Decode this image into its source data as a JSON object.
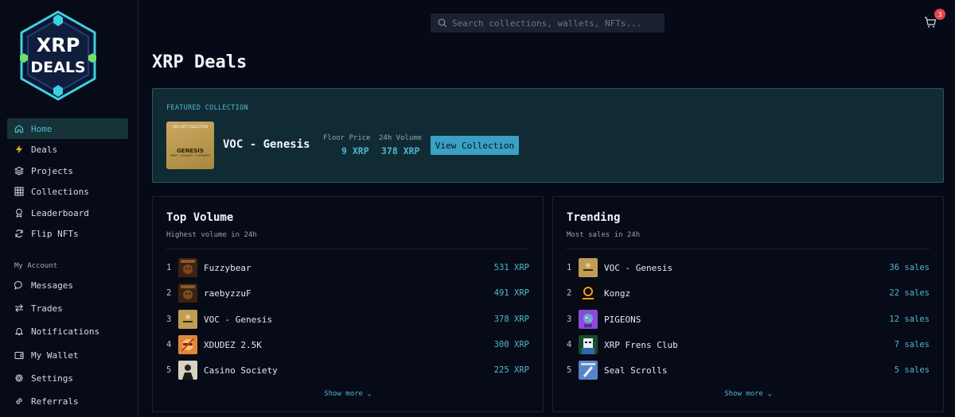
{
  "app": {
    "logo_text_top": "XRP",
    "logo_text_bottom": "DEALS",
    "title": "XRP Deals",
    "accent": "#4fb8cf"
  },
  "sidebar": {
    "items": [
      {
        "label": "Home",
        "icon": "home-icon"
      },
      {
        "label": "Deals",
        "icon": "lightning-icon"
      },
      {
        "label": "Projects",
        "icon": "layers-icon"
      },
      {
        "label": "Collections",
        "icon": "grid-icon"
      },
      {
        "label": "Leaderboard",
        "icon": "award-icon"
      },
      {
        "label": "Flip NFTs",
        "icon": "refresh-icon"
      }
    ],
    "account_label": "My Account",
    "account_items": [
      {
        "label": "Messages",
        "icon": "message-icon"
      },
      {
        "label": "Trades",
        "icon": "swap-icon"
      },
      {
        "label": "Notifications",
        "icon": "bell-icon"
      },
      {
        "label": "My Wallet",
        "icon": "wallet-icon"
      },
      {
        "label": "Settings",
        "icon": "gear-icon"
      },
      {
        "label": "Referrals",
        "icon": "link-icon"
      }
    ]
  },
  "header": {
    "search_placeholder": "Search collections, wallets, NFTs...",
    "cart_count": "3"
  },
  "featured": {
    "label": "FEATURED COLLECTION",
    "thumb_caption": "VOC ART COLLECTION",
    "thumb_title": "GENESIS",
    "thumb_tagline": "MINT · COLLECT · CULTIVATE",
    "name": "VOC - Genesis",
    "floor_label": "Floor Price",
    "floor_value": "9 XRP",
    "volume_label": "24h Volume",
    "volume_value": "378 XRP",
    "button": "View Collection"
  },
  "top_volume": {
    "title": "Top Volume",
    "subtitle": "Highest volume in 24h",
    "rows": [
      {
        "rank": "1",
        "name": "Fuzzybear",
        "value": "531 XRP"
      },
      {
        "rank": "2",
        "name": "raebyzzuF",
        "value": "491 XRP"
      },
      {
        "rank": "3",
        "name": "VOC - Genesis",
        "value": "378 XRP"
      },
      {
        "rank": "4",
        "name": "XDUDEZ 2.5K",
        "value": "300 XRP"
      },
      {
        "rank": "5",
        "name": "Casino Society",
        "value": "225 XRP"
      }
    ],
    "show_more": "Show more ⌄"
  },
  "trending": {
    "title": "Trending",
    "subtitle": "Most sales in 24h",
    "rows": [
      {
        "rank": "1",
        "name": "VOC - Genesis",
        "value": "36 sales"
      },
      {
        "rank": "2",
        "name": "Kongz",
        "value": "22 sales"
      },
      {
        "rank": "3",
        "name": "PIGEONS",
        "value": "12 sales"
      },
      {
        "rank": "4",
        "name": "XRP Frens Club",
        "value": "7 sales"
      },
      {
        "rank": "5",
        "name": "Seal Scrolls",
        "value": "5 sales"
      }
    ],
    "show_more": "Show more ⌄"
  }
}
